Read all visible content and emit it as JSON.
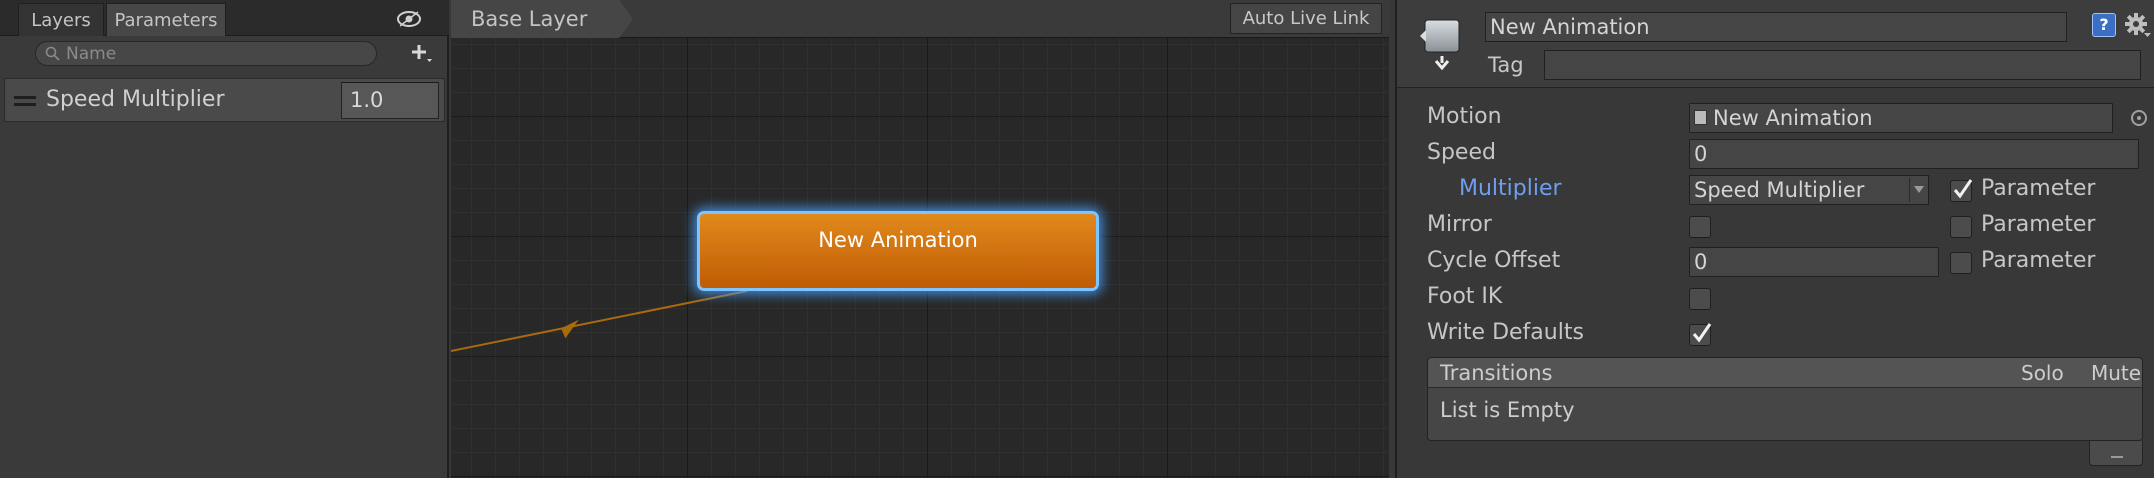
{
  "left_panel": {
    "tabs": [
      {
        "label": "Layers"
      },
      {
        "label": "Parameters"
      }
    ],
    "search": {
      "placeholder": "Name"
    },
    "parameters": [
      {
        "name": "Speed Multiplier",
        "value": "1.0"
      }
    ]
  },
  "graph": {
    "breadcrumb": "Base Layer",
    "auto_live_link": "Auto Live Link",
    "state_node": {
      "label": "New Animation",
      "color": "#d97a12",
      "highlight": "#7ec4ff"
    },
    "transition_color": "#a86a0c"
  },
  "inspector": {
    "state_name": "New Animation",
    "tag_label": "Tag",
    "tag_value": "",
    "help_icon": "?",
    "properties": {
      "motion_label": "Motion",
      "motion_value": "New Animation",
      "speed_label": "Speed",
      "speed_value": "0",
      "multiplier_label": "Multiplier",
      "multiplier_value": "Speed Multiplier",
      "multiplier_parameter_label": "Parameter",
      "multiplier_parameter_checked": true,
      "mirror_label": "Mirror",
      "mirror_checked": false,
      "mirror_parameter_label": "Parameter",
      "mirror_parameter_checked": false,
      "cycle_offset_label": "Cycle Offset",
      "cycle_offset_value": "0",
      "cycle_offset_parameter_label": "Parameter",
      "cycle_offset_parameter_checked": false,
      "foot_ik_label": "Foot IK",
      "foot_ik_checked": false,
      "write_defaults_label": "Write Defaults",
      "write_defaults_checked": true
    },
    "transitions": {
      "title": "Transitions",
      "solo_label": "Solo",
      "mute_label": "Mute",
      "empty_text": "List is Empty"
    }
  },
  "colors": {
    "multiplier_label": "#6f9ef0",
    "state_node_orange": "#d97a12"
  }
}
